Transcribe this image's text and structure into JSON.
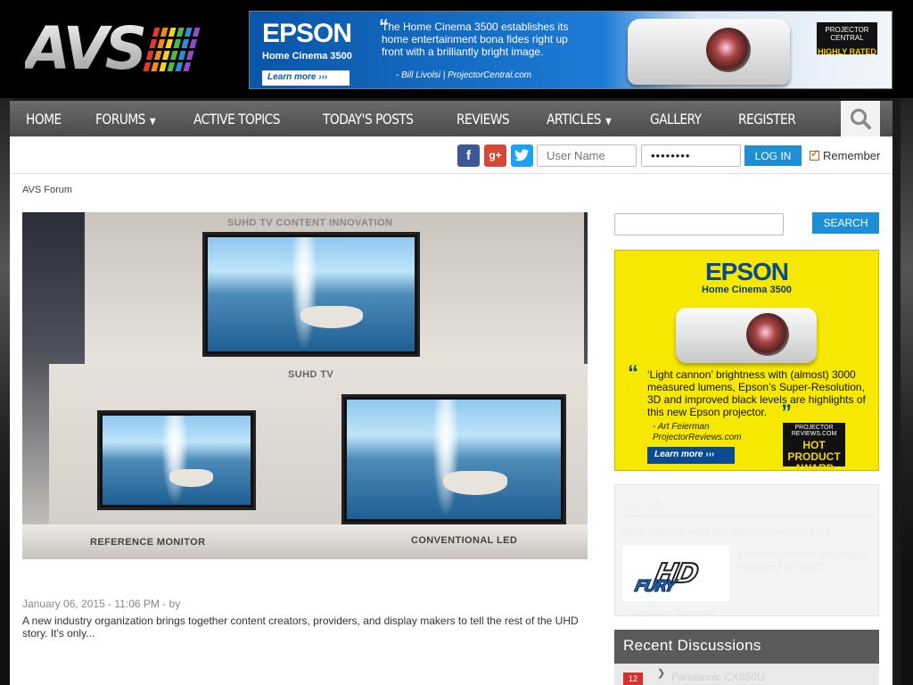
{
  "site": {
    "logo_text": "AVS",
    "logo_bar_colors": [
      "#e23a2a",
      "#f08a1c",
      "#f4d21f",
      "#4cb84a",
      "#2a8fd8",
      "#8e4cc6"
    ]
  },
  "top_ad": {
    "brand": "EPSON",
    "model": "Home Cinema 3500",
    "quote": "The Home Cinema 3500 establishes its home entertainment bona fides right up front with a brilliantly bright image.",
    "attribution": "- Bill Livolsi  |  ProjectorCentral.com",
    "learn_more": "Learn more ›››",
    "badge_top": "PROJECTOR CENTRAL",
    "badge_bottom": "HIGHLY RATED"
  },
  "nav": {
    "items": [
      {
        "label": "Home",
        "has_dropdown": false
      },
      {
        "label": "Forums",
        "has_dropdown": true
      },
      {
        "label": "Active Topics",
        "has_dropdown": false
      },
      {
        "label": "Today's Posts",
        "has_dropdown": false
      },
      {
        "label": "Reviews",
        "has_dropdown": false
      },
      {
        "label": "Articles",
        "has_dropdown": true
      },
      {
        "label": "Gallery",
        "has_dropdown": false
      },
      {
        "label": "Register",
        "has_dropdown": false
      }
    ],
    "caret": "▼",
    "search_icon": "search-icon"
  },
  "login": {
    "facebook": "f",
    "googleplus": "g+",
    "twitter": "t",
    "username_placeholder": "User Name",
    "password_value": "••••••••",
    "login_label": "LOG IN",
    "remember_label": "Remember"
  },
  "breadcrumb": "AVS Forum",
  "hero": {
    "top_caption": "SUHD TV CONTENT INNOVATION",
    "suhd_label": "SUHD TV",
    "left_caption": "REFERENCE MONITOR",
    "right_caption": "CONVENTIONAL LED"
  },
  "post": {
    "meta": "January 06, 2015 - 11:06 PM - by",
    "excerpt": "A new industry organization brings together content creators, providers, and display makers to tell the rest of the UHD story. It's only..."
  },
  "sidebar": {
    "search_label": "SEARCH",
    "ad": {
      "brand": "EPSON",
      "model": "Home Cinema 3500",
      "quote": "‘Light cannon’ brightness with (almost) 3000 measured lumens, Epson’s Super-Resolution, 3D and improved black levels are highlights of this new Epson projector.",
      "attrib_name": "- Art Feierman",
      "attrib_site": "ProjectorReviews.com",
      "learn_more": "Learn more ›››",
      "award_top": "PROJECTOR REVIEWS.COM",
      "award_bottom": "HOT PRODUCT AWARD"
    },
    "sponsors": {
      "title": "Sponsors",
      "ghost_line": "Stay current with our latest news content",
      "ghost_text": "Intuitive, reliable and highly regarded products",
      "ghost_footer": "Find More Sponsors",
      "hdfury_top": "HD",
      "hdfury_bottom": "FURY"
    },
    "recent": {
      "title": "Recent Discussions",
      "first_count": "12",
      "first_topic": "Panasonic CX850U"
    }
  }
}
